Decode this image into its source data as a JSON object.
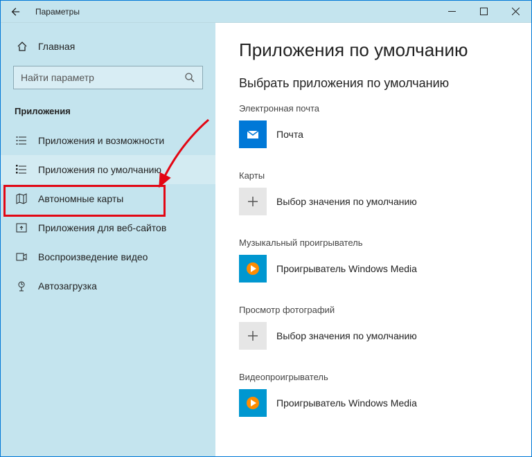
{
  "titlebar": {
    "title": "Параметры"
  },
  "sidebar": {
    "home": "Главная",
    "search_placeholder": "Найти параметр",
    "section": "Приложения",
    "items": [
      {
        "label": "Приложения и возможности"
      },
      {
        "label": "Приложения по умолчанию"
      },
      {
        "label": "Автономные карты"
      },
      {
        "label": "Приложения для веб-сайтов"
      },
      {
        "label": "Воспроизведение видео"
      },
      {
        "label": "Автозагрузка"
      }
    ]
  },
  "main": {
    "title": "Приложения по умолчанию",
    "subtitle": "Выбрать приложения по умолчанию",
    "categories": [
      {
        "label": "Электронная почта",
        "app": "Почта"
      },
      {
        "label": "Карты",
        "app": "Выбор значения по умолчанию"
      },
      {
        "label": "Музыкальный проигрыватель",
        "app": "Проигрыватель Windows Media"
      },
      {
        "label": "Просмотр фотографий",
        "app": "Выбор значения по умолчанию"
      },
      {
        "label": "Видеопроигрыватель",
        "app": "Проигрыватель Windows Media"
      }
    ]
  }
}
